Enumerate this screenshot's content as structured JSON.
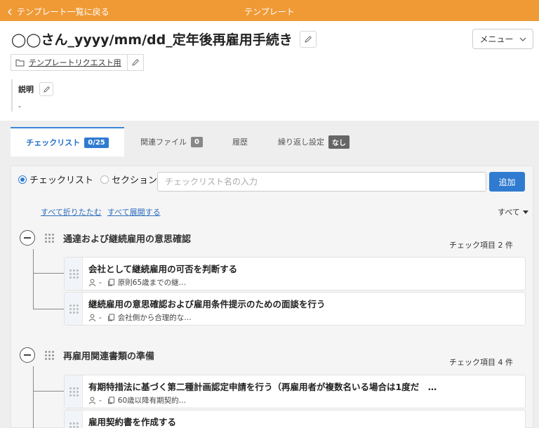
{
  "topbar": {
    "back_label": "テンプレート一覧に戻る",
    "title": "テンプレート"
  },
  "template": {
    "title": "◯◯さん_yyyy/mm/dd_定年後再雇用手続き",
    "menu_label": "メニュー"
  },
  "folder": {
    "label": "テンプレートリクエスト用"
  },
  "description": {
    "label": "説明",
    "value": "-"
  },
  "tabs": [
    {
      "label": "チェックリスト",
      "badge": "0/25"
    },
    {
      "label": "関連ファイル",
      "badge": "0"
    },
    {
      "label": "履歴",
      "badge": ""
    },
    {
      "label": "繰り返し設定",
      "badge": "なし"
    }
  ],
  "add": {
    "radio_checklist": "チェックリスト",
    "radio_section": "セクション",
    "placeholder": "チェックリスト名の入力",
    "button": "追加"
  },
  "controls": {
    "collapse_all": "すべて折りたたむ",
    "expand_all": "すべて展開する",
    "filter": "すべて"
  },
  "sections": [
    {
      "title": "通達および継続雇用の意思確認",
      "count": "チェック項目 2 件",
      "items": [
        {
          "title": "会社として継続雇用の可否を判断する",
          "assignee": "-",
          "note": "原則65歳までの継…"
        },
        {
          "title": "継続雇用の意思確認および雇用条件提示のための面談を行う",
          "assignee": "-",
          "note": "会社側から合理的な…"
        }
      ]
    },
    {
      "title": "再雇用関連書類の準備",
      "count": "チェック項目 4 件",
      "items": [
        {
          "title": "有期特措法に基づく第二種計画認定申請を行う（再雇用者が複数名いる場合は1度だ　…",
          "assignee": "-",
          "note": "60歳以降有期契約…"
        },
        {
          "title": "雇用契約書を作成する",
          "assignee": "",
          "note": ""
        }
      ]
    }
  ]
}
